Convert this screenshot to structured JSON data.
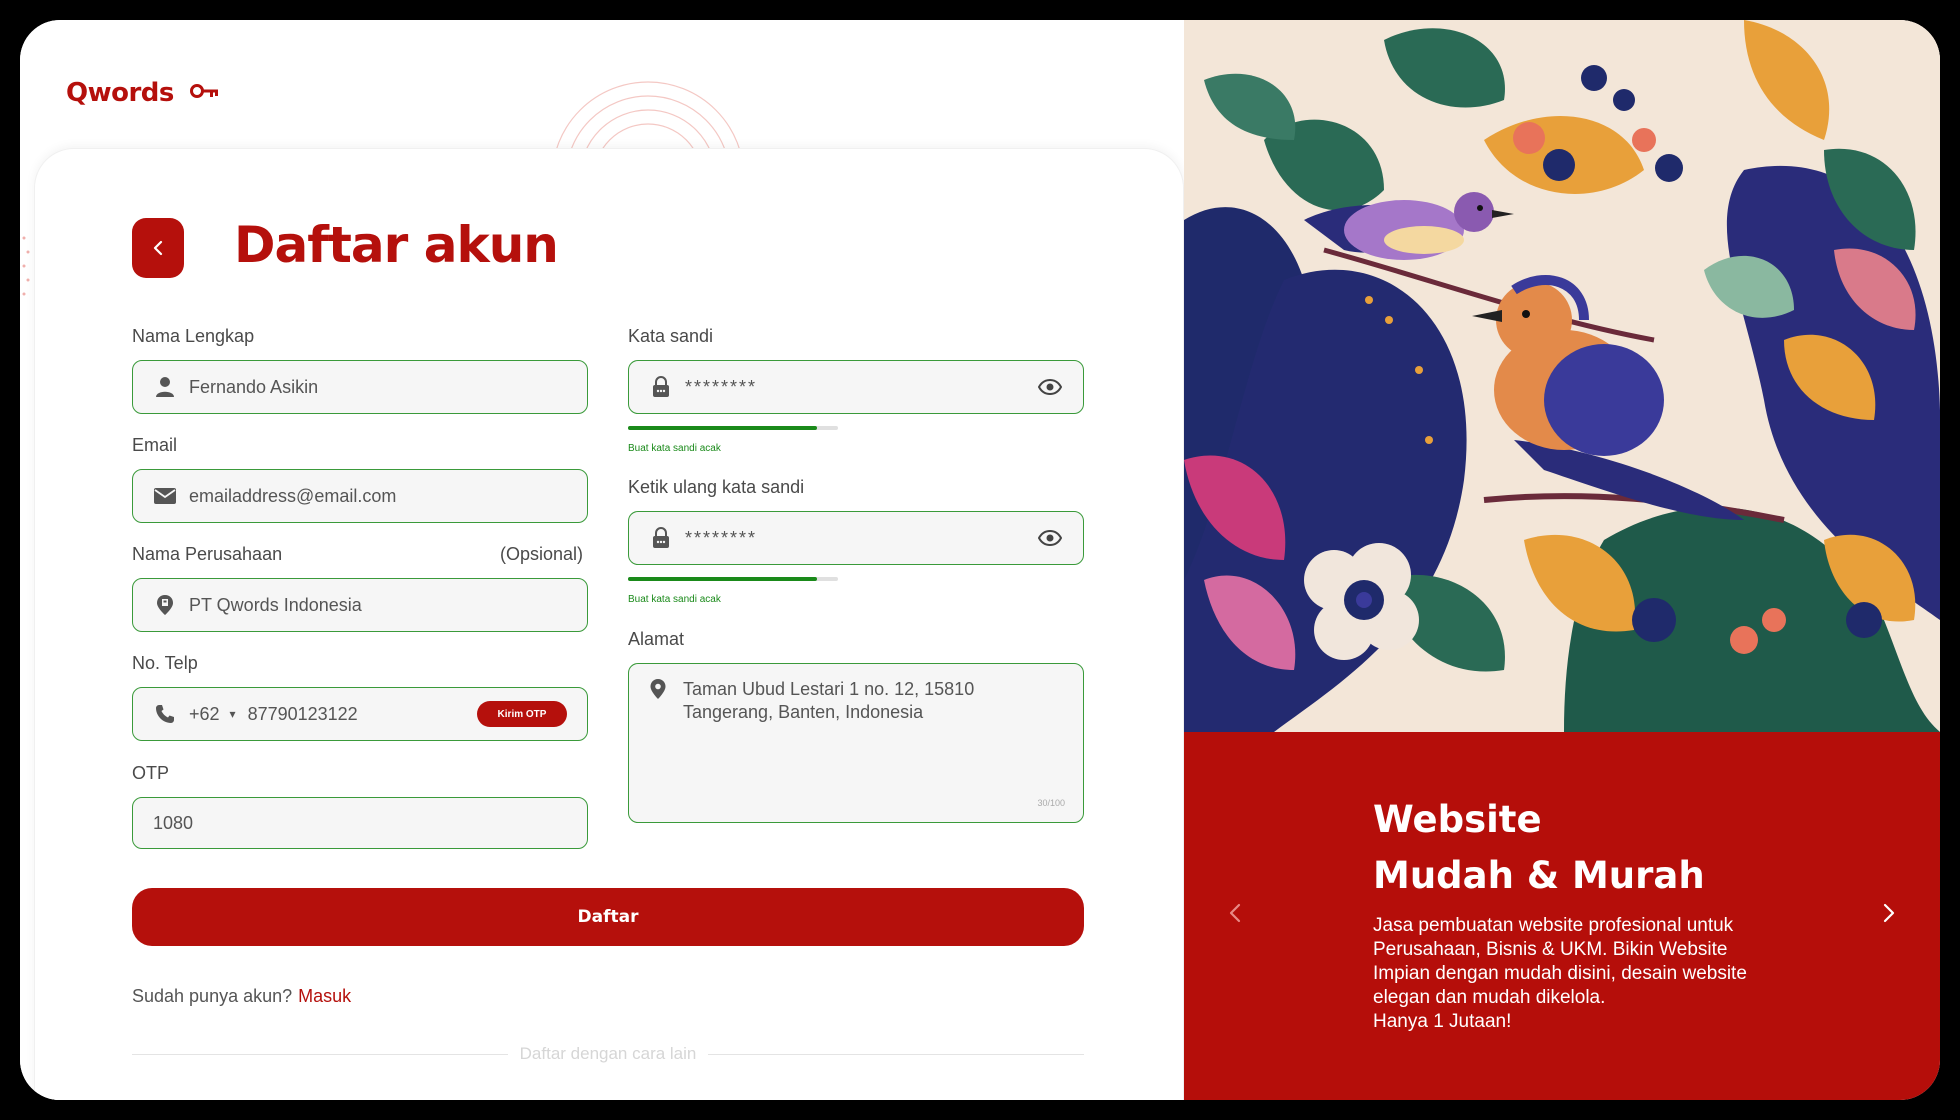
{
  "brand": {
    "name": "Qwords"
  },
  "page": {
    "title": "Daftar akun"
  },
  "form": {
    "full_name": {
      "label": "Nama Lengkap",
      "value": "Fernando Asikin"
    },
    "email": {
      "label": "Email",
      "value": "emailaddress@email.com"
    },
    "company": {
      "label": "Nama Perusahaan",
      "optional": "(Opsional)",
      "value": "PT Qwords Indonesia"
    },
    "phone": {
      "label": "No. Telp",
      "code": "+62",
      "value": "87790123122",
      "otp_button": "Kirim OTP"
    },
    "otp": {
      "label": "OTP",
      "value": "1080"
    },
    "password": {
      "label": "Kata sandi",
      "value": "********",
      "hint": "Buat kata sandi acak",
      "strength": 0.9
    },
    "password_confirm": {
      "label": "Ketik ulang kata sandi",
      "value": "********",
      "hint": "Buat kata sandi acak",
      "strength": 0.9
    },
    "address": {
      "label": "Alamat",
      "value": "Taman Ubud Lestari 1 no. 12, 15810\nTangerang, Banten, Indonesia",
      "counter": "30/100"
    },
    "submit": "Daftar",
    "signin_prompt": "Sudah punya akun?",
    "signin_link": "Masuk",
    "divider": "Daftar dengan cara lain"
  },
  "promo": {
    "title_line1": "Website",
    "title_line2": "Mudah & Murah",
    "description": "Jasa pembuatan website profesional untuk Perusahaan, Bisnis & UKM. Bikin Website Impian dengan mudah disini, desain website elegan dan mudah dikelola.",
    "tagline": "Hanya 1 Jutaan!"
  },
  "colors": {
    "brand": "#b5100c",
    "success": "#1a8a1a",
    "field_border": "#3a9a3a"
  },
  "icons": [
    "key-icon",
    "back-chevron-icon",
    "user-icon",
    "mail-icon",
    "building-pin-icon",
    "phone-icon",
    "lock-icon",
    "eye-icon",
    "location-pin-icon",
    "chevron-left-icon",
    "chevron-right-icon"
  ]
}
